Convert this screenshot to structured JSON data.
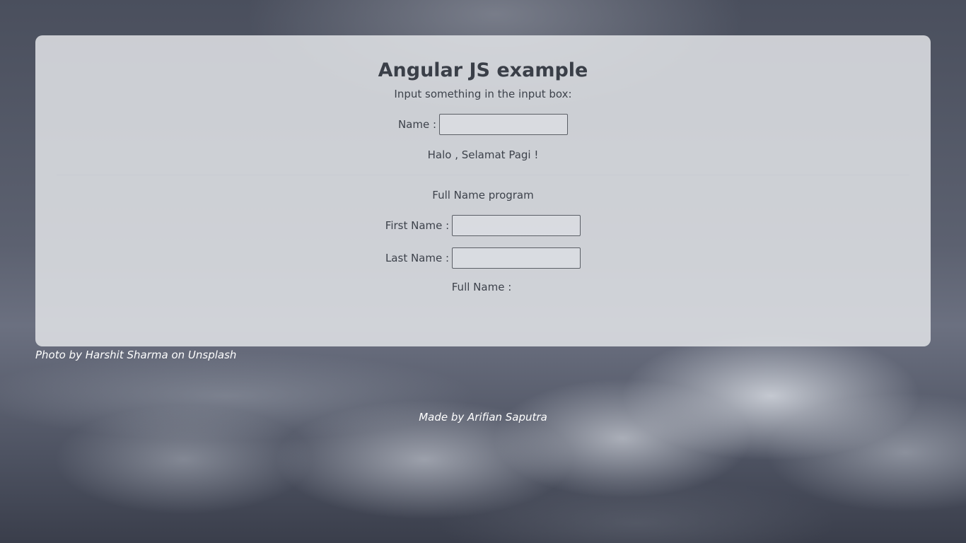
{
  "card": {
    "title": "Angular JS example",
    "instruction": "Input something in the input box:",
    "name_label": "Name :",
    "name_value": "",
    "greeting": "Halo , Selamat Pagi !",
    "section_title": "Full Name program",
    "first_name_label": "First Name :",
    "first_name_value": "",
    "last_name_label": "Last Name :",
    "last_name_value": "",
    "full_name_label": "Full Name :",
    "full_name_value": ""
  },
  "photo_credit": "Photo by Harshit Sharma on Unsplash",
  "footer": "Made by Arifian Saputra",
  "colors": {
    "card_background": "#e1e3e7",
    "text": "#3d424b",
    "credit_text": "#ffffff"
  }
}
